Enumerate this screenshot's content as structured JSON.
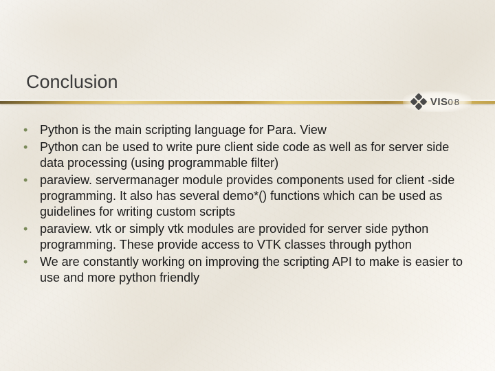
{
  "title": "Conclusion",
  "logo": {
    "brand": "VIS",
    "suffix": "08"
  },
  "bullets": [
    "Python is the main scripting language for Para. View",
    "Python can be used to write pure client side code as well as for server side data processing (using programmable filter)",
    "paraview. servermanager module provides components used for client -side programming. It also has several demo*() functions which can be used as guidelines for writing custom scripts",
    "paraview. vtk or simply vtk modules are provided for server side python programming. These provide access to VTK classes through python",
    "We are constantly working on improving the scripting API to make is easier to use and more python friendly"
  ]
}
